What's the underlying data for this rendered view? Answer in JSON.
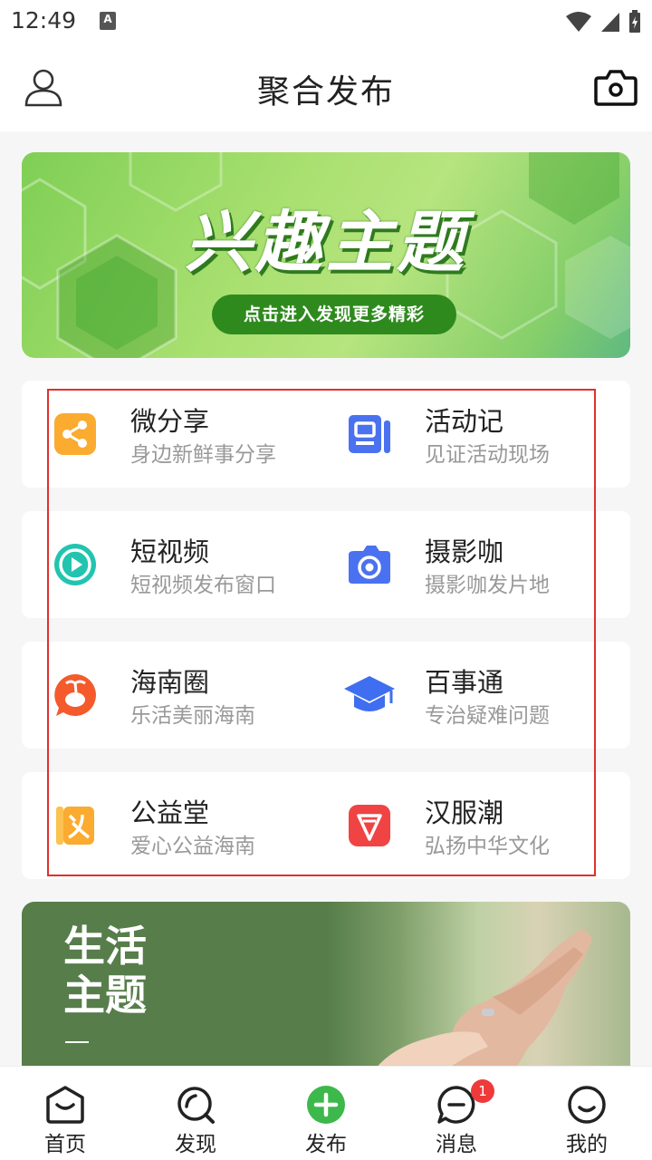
{
  "status_bar": {
    "time": "12:49",
    "a_icon": "A"
  },
  "header": {
    "title": "聚合发布",
    "left_icon": "user-icon",
    "right_icon": "camera-icon"
  },
  "banner_interest": {
    "title": "兴趣主题",
    "button": "点击进入发现更多精彩"
  },
  "grid": {
    "items": [
      {
        "title": "微分享",
        "subtitle": "身边新鲜事分享",
        "icon": "share-icon",
        "color": "#fbab2f"
      },
      {
        "title": "活动记",
        "subtitle": "见证活动现场",
        "icon": "activity-record-icon",
        "color": "#4a72f0"
      },
      {
        "title": "短视频",
        "subtitle": "短视频发布窗口",
        "icon": "video-play-icon",
        "color": "#22c4b0"
      },
      {
        "title": "摄影咖",
        "subtitle": "摄影咖发片地",
        "icon": "photo-camera-icon",
        "color": "#4a72f0"
      },
      {
        "title": "海南圈",
        "subtitle": "乐活美丽海南",
        "icon": "hainan-island-icon",
        "color": "#f45a2c"
      },
      {
        "title": "百事通",
        "subtitle": "专治疑难问题",
        "icon": "graduation-cap-icon",
        "color": "#3f6ef0"
      },
      {
        "title": "公益堂",
        "subtitle": "爱心公益海南",
        "icon": "charity-icon",
        "color": "#fbab2f"
      },
      {
        "title": "汉服潮",
        "subtitle": "弘扬中华文化",
        "icon": "hanfu-icon",
        "color": "#f04444"
      }
    ]
  },
  "banner_life": {
    "title_line1": "生活",
    "title_line2": "主题"
  },
  "bottom_nav": {
    "items": [
      {
        "label": "首页",
        "icon": "home-icon"
      },
      {
        "label": "发现",
        "icon": "discover-icon"
      },
      {
        "label": "发布",
        "icon": "publish-plus-icon",
        "color": "#3db84a"
      },
      {
        "label": "消息",
        "icon": "message-icon",
        "badge": "1"
      },
      {
        "label": "我的",
        "icon": "profile-smile-icon"
      }
    ]
  }
}
